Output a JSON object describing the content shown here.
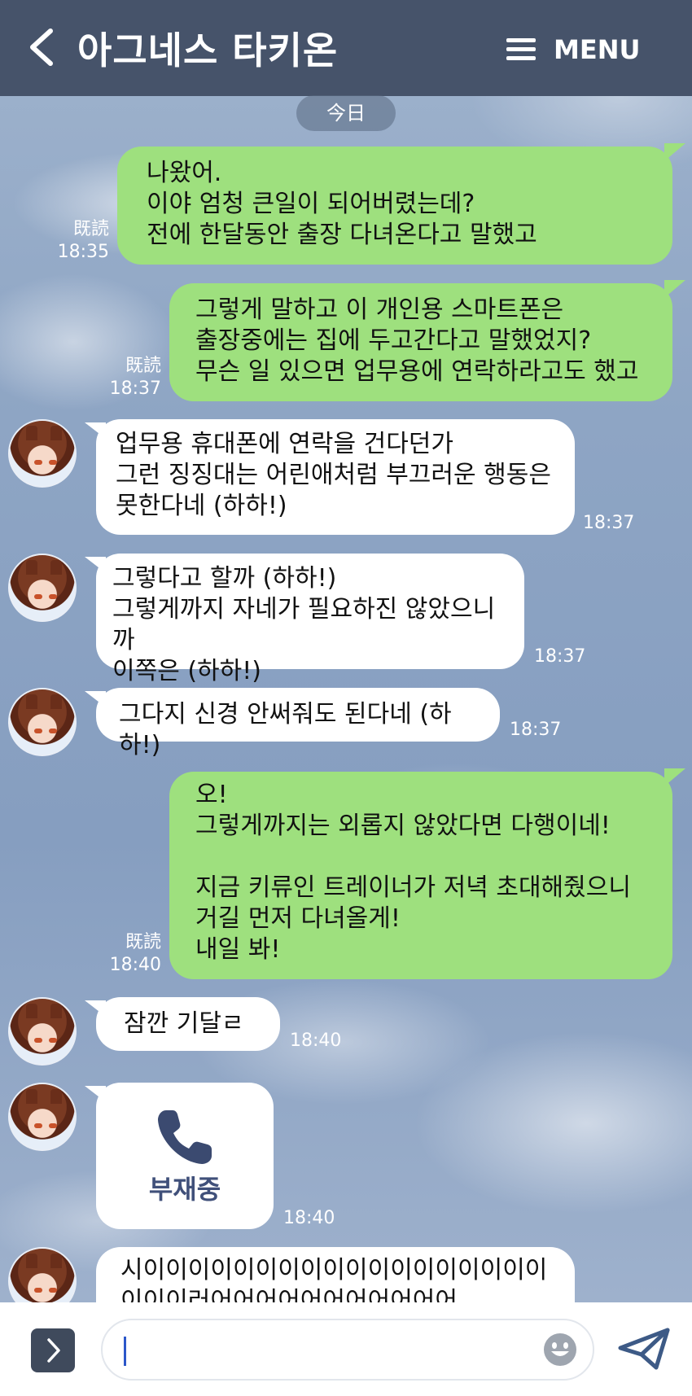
{
  "header": {
    "title": "아그네스 타키온",
    "menu_label": "MENU",
    "back_icon": "back-arrow-icon",
    "menu_icon": "hamburger-menu-icon"
  },
  "date_divider": "今日",
  "read_label": "既読",
  "messages": [
    {
      "from": "me",
      "text": "나왔어.\n이야 엄청 큰일이 되어버렸는데?\n전에 한달동안 출장 다녀온다고 말했고",
      "time": "18:35",
      "read": "既読"
    },
    {
      "from": "me",
      "text": "그렇게 말하고 이 개인용 스마트폰은\n출장중에는 집에 두고간다고 말했었지?\n무슨 일 있으면 업무용에 연락하라고도 했고",
      "time": "18:37",
      "read": "既読"
    },
    {
      "from": "them",
      "text": "업무용 휴대폰에 연락을 건다던가\n그런 징징대는 어린애처럼 부끄러운 행동은\n못한다네 (하하!)",
      "time": "18:37"
    },
    {
      "from": "them",
      "text": "그렇다고 할까 (하하!)\n그렇게까지 자네가 필요하진 않았으니까\n이쪽은 (하하!)",
      "time": "18:37"
    },
    {
      "from": "them",
      "text": "그다지 신경 안써줘도 된다네 (하하!)",
      "time": "18:37"
    },
    {
      "from": "me",
      "text": "오!\n그렇게까지는 외롭지 않았다면 다행이네!\n\n지금 키류인 트레이너가 저녁 초대해줬으니\n거길 먼저 다녀올게!\n내일 봐!",
      "time": "18:40",
      "read": "既読"
    },
    {
      "from": "them",
      "text": "잠깐 기달ㄹ",
      "time": "18:40"
    },
    {
      "from": "them",
      "type": "call",
      "text": "부재중",
      "time": "18:40",
      "icon": "phone-icon"
    },
    {
      "from": "them",
      "text": "시이이이이이이이이이이이이이이이이이이\n이이이러어어어어어어어어어어어",
      "time": ""
    }
  ],
  "input": {
    "value": "",
    "expand_icon": "chevron-right-icon",
    "emoji_icon": "smiley-icon",
    "send_icon": "paper-plane-icon"
  },
  "colors": {
    "header_bg": "#46536a",
    "sent_bubble": "#9ee07e",
    "received_bubble": "#ffffff",
    "call_text": "#40507a"
  }
}
